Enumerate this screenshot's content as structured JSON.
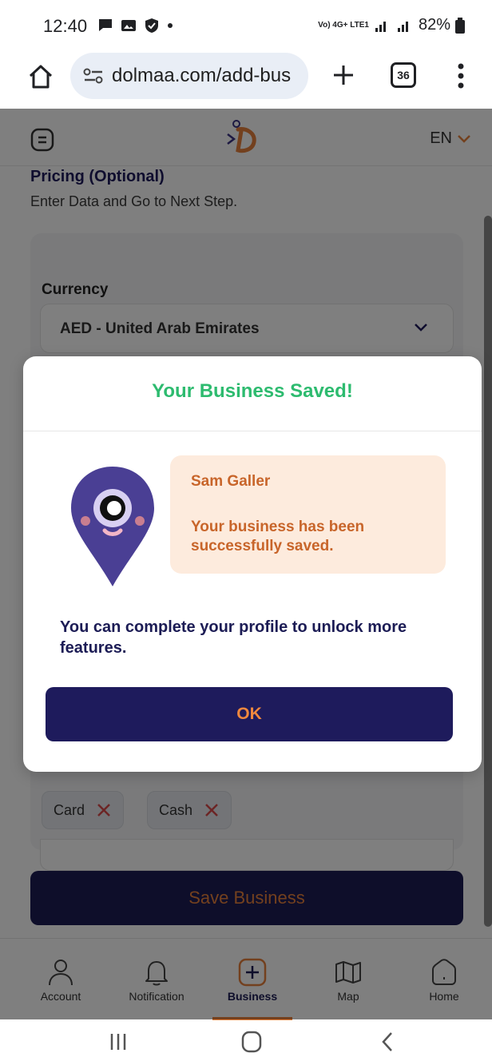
{
  "status_bar": {
    "time": "12:40",
    "network": "Vo) 4G+ LTE1",
    "battery": "82%"
  },
  "browser": {
    "url": "dolmaa.com/add-bus",
    "tab_count": "36"
  },
  "app_header": {
    "language": "EN"
  },
  "form": {
    "section_title": "Pricing (Optional)",
    "section_subtitle": "Enter Data and Go to Next Step.",
    "currency_label": "Currency",
    "currency_value": "AED - United Arab Emirates",
    "payment_chips": [
      "Card",
      "Cash"
    ],
    "save_label": "Save Business"
  },
  "modal": {
    "title": "Your Business Saved!",
    "user_name": "Sam Galler",
    "message": "Your business has been successfully saved.",
    "hint": "You can complete your profile to unlock more features.",
    "ok_label": "OK"
  },
  "bottom_nav": {
    "items": [
      {
        "label": "Account",
        "icon": "person-icon"
      },
      {
        "label": "Notification",
        "icon": "bell-icon"
      },
      {
        "label": "Business",
        "icon": "plus-square-icon",
        "active": true
      },
      {
        "label": "Map",
        "icon": "map-icon"
      },
      {
        "label": "Home",
        "icon": "home-icon"
      }
    ]
  },
  "colors": {
    "brand_navy": "#1e1b5c",
    "accent_orange": "#e7813d",
    "success_green": "#2dbb6f",
    "bubble_bg": "#fdebdd"
  }
}
